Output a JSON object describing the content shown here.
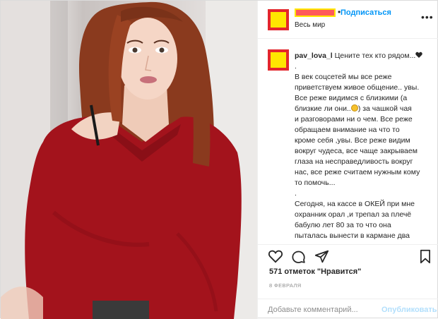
{
  "header": {
    "follow_label": "Подписаться",
    "separator": "•",
    "location": "Весь мир",
    "more_label": "•••"
  },
  "caption": {
    "username": "pav_lova_l",
    "first": "Цените тех кто рядом...",
    "lines": [
      ".",
      "В век соцсетей мы все реже",
      "приветствуем живое общение.. увы.",
      "Все реже видимся с близкими (а",
      "близкие ли они..",
      ") за чашкой чая",
      "и разговорами ни о чем. Все реже",
      "обращаем внимание на что то",
      "кроме себя ,увы. Все реже видим",
      "вокруг чудеса, все чаще закрываем",
      "глаза на несправедливость вокруг",
      "нас, все реже считаем нужным кому",
      "то помочь...",
      ".",
      "Сегодня, на кассе в ОКЕЙ при мне",
      "охранник орал ,и трепал за плечё",
      "бабулю лет 80 за то что она",
      "пыталась вынести в кармане два"
    ]
  },
  "actions": {
    "like_icon": "heart-icon",
    "comment_icon": "comment-icon",
    "share_icon": "share-icon",
    "save_icon": "bookmark-icon"
  },
  "likes_text": "571 отметок \"Нравится\"",
  "date_text": "8 ФЕВРАЛЯ",
  "comment": {
    "placeholder": "Добавьте комментарий...",
    "publish_label": "Опубликовать"
  },
  "colors": {
    "accent": "#0095f6",
    "avatar_fill": "#ffe600",
    "avatar_border": "#e3262c",
    "sweater": "#a3131c"
  }
}
